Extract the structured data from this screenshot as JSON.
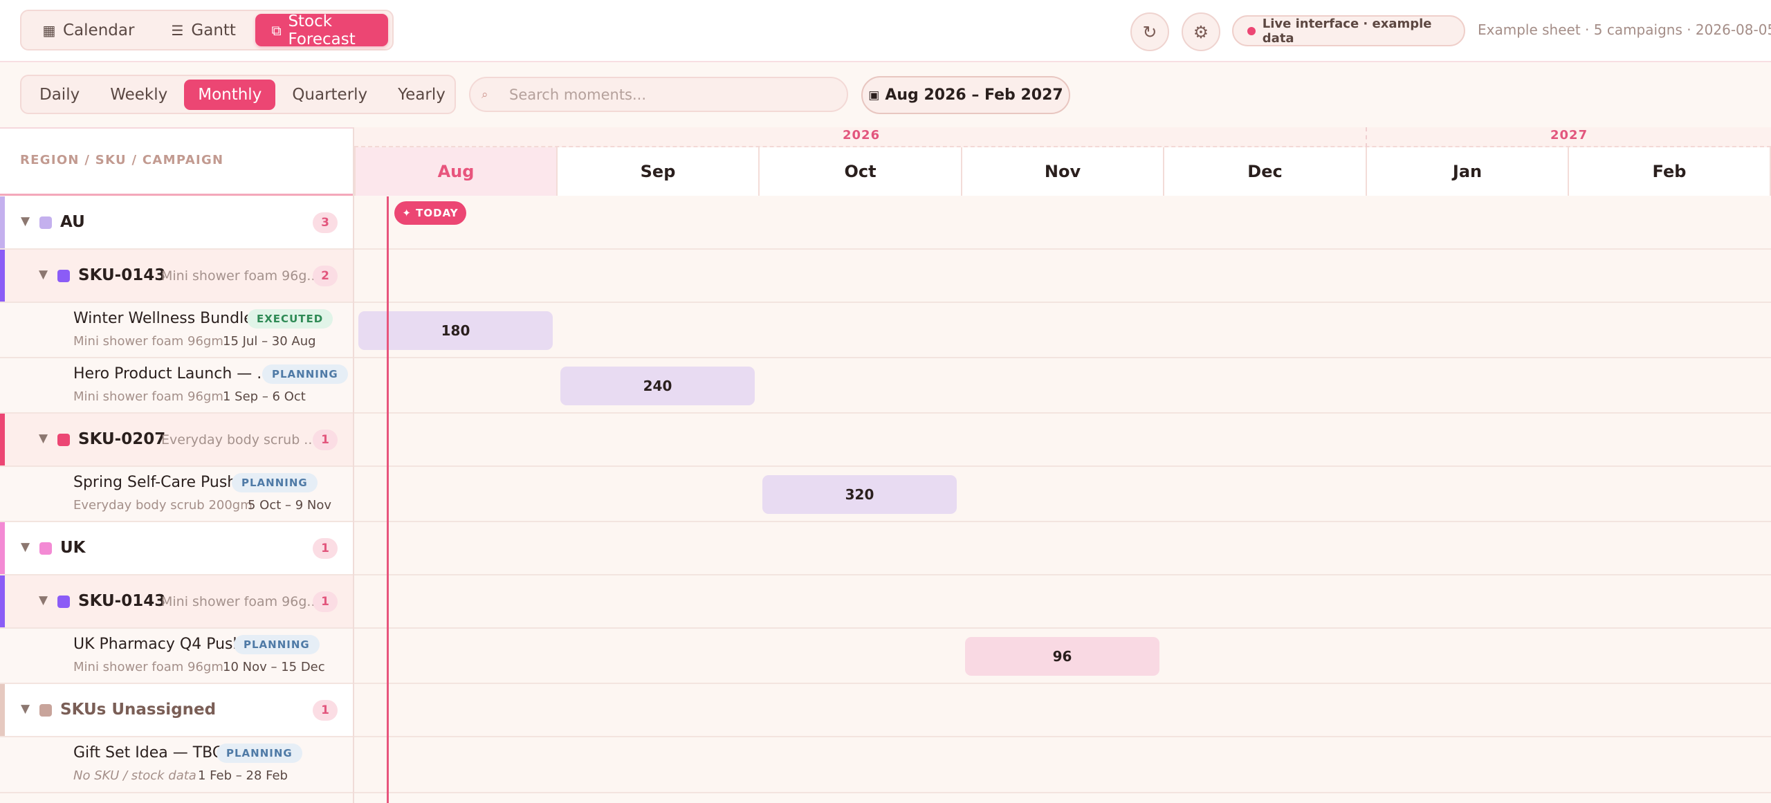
{
  "view_tabs": [
    {
      "icon": "▦",
      "label": "Calendar"
    },
    {
      "icon": "☰",
      "label": "Gantt"
    },
    {
      "icon": "⧉",
      "label": "Stock Forecast"
    }
  ],
  "header": {
    "refresh_icon": "↻",
    "settings_icon": "⚙",
    "live_label": "Live interface · example data",
    "sheet_info": "Example sheet · 5 campaigns · 2026-08-05"
  },
  "scale_tabs": [
    "Daily",
    "Weekly",
    "Monthly",
    "Quarterly",
    "Yearly"
  ],
  "search": {
    "placeholder": "Search moments..."
  },
  "date_range": {
    "icon": "▣",
    "label": "Aug 2026 – Feb 2027"
  },
  "grid": {
    "column_header": "REGION / SKU / CAMPAIGN",
    "years": [
      "2026",
      "2027"
    ],
    "months": [
      "Aug",
      "Sep",
      "Oct",
      "Nov",
      "Dec",
      "Jan",
      "Feb"
    ],
    "today_label": "✦ TODAY"
  },
  "rows": {
    "au": {
      "name": "AU",
      "count": "3"
    },
    "au_sku0143": {
      "code": "SKU-0143",
      "desc": "Mini shower foam 96g...",
      "count": "2"
    },
    "c1": {
      "name": "Winter Wellness Bundle",
      "status": "EXECUTED",
      "sku": "Mini shower foam 96gm",
      "dates": "15 Jul – 30 Aug",
      "qty": "180"
    },
    "c2": {
      "name": "Hero Product Launch — ...",
      "status": "PLANNING",
      "sku": "Mini shower foam 96gm",
      "dates": "1 Sep – 6 Oct",
      "qty": "240"
    },
    "au_sku0207": {
      "code": "SKU-0207",
      "desc": "Everyday body scrub ...",
      "count": "1"
    },
    "c3": {
      "name": "Spring Self-Care Push",
      "status": "PLANNING",
      "sku": "Everyday body scrub 200gm",
      "dates": "5 Oct – 9 Nov",
      "qty": "320"
    },
    "uk": {
      "name": "UK",
      "count": "1"
    },
    "uk_sku0143": {
      "code": "SKU-0143",
      "desc": "Mini shower foam 96g...",
      "count": "1"
    },
    "c4": {
      "name": "UK Pharmacy Q4 Push",
      "status": "PLANNING",
      "sku": "Mini shower foam 96gm",
      "dates": "10 Nov – 15 Dec",
      "qty": "96"
    },
    "unassigned": {
      "name": "SKUs Unassigned",
      "count": "1"
    },
    "c5": {
      "name": "Gift Set Idea — TBC",
      "status": "PLANNING",
      "sku": "No SKU / stock data",
      "dates": "1 Feb – 28 Feb"
    }
  },
  "colors": {
    "accent": "#ec4673",
    "au": "#c4b0ee",
    "sku0143": "#8b5cf6",
    "sku0207": "#ec4673",
    "uk": "#f38ad4",
    "unassigned": "#c8a49b"
  }
}
